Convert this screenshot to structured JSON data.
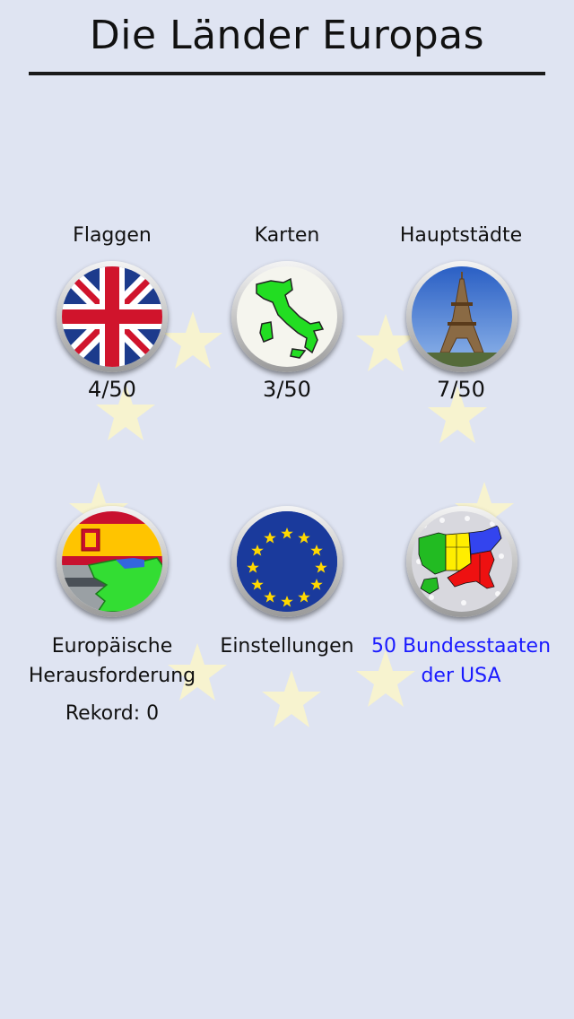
{
  "header": {
    "title": "Die Länder Europas"
  },
  "menu": {
    "flags": {
      "label": "Flaggen",
      "progress": "4/50",
      "icon": "uk-flag-icon"
    },
    "maps": {
      "label": "Karten",
      "progress": "3/50",
      "icon": "italy-map-icon"
    },
    "capitals": {
      "label": "Hauptstädte",
      "progress": "7/50",
      "icon": "eiffel-tower-icon"
    },
    "challenge": {
      "label_line1": "Europäische",
      "label_line2": "Herausforderung",
      "record": "Rekord: 0",
      "icon": "spain-challenge-icon"
    },
    "settings": {
      "label": "Einstellungen",
      "icon": "eu-flag-icon"
    },
    "usa": {
      "label_line1": "50 Bundesstaaten",
      "label_line2": "der USA",
      "icon": "usa-map-icon",
      "color": "#1a1aff"
    }
  },
  "colors": {
    "background": "#dfe4f2",
    "star": "#f7f3cf"
  }
}
